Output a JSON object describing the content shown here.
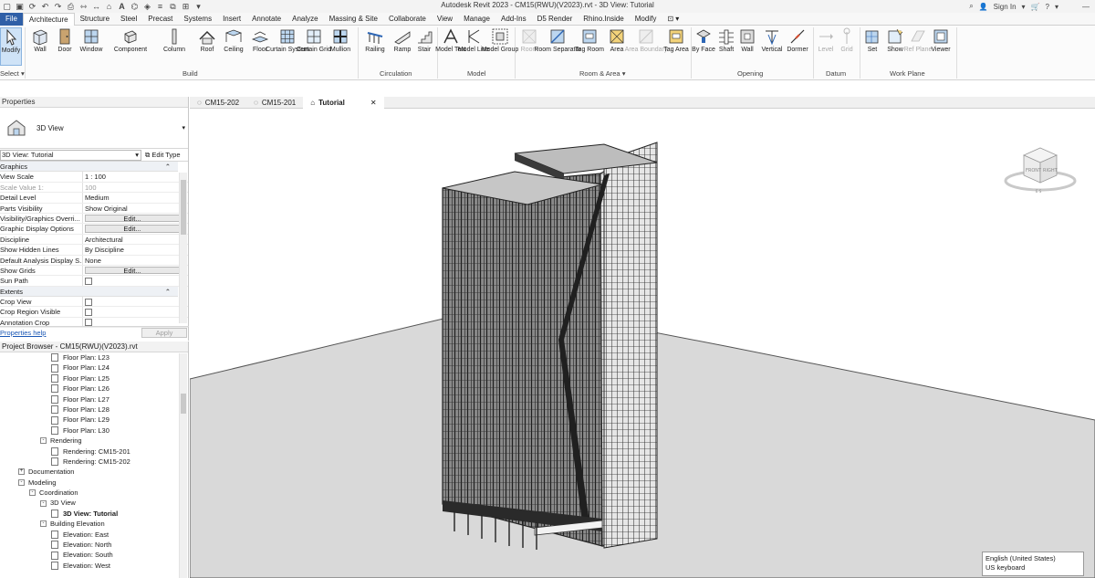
{
  "window": {
    "title": "Autodesk Revit 2023 - CM15(RWU)(V2023).rvt - 3D View: Tutorial",
    "sign_in": "Sign In"
  },
  "tabs": [
    "File",
    "Architecture",
    "Structure",
    "Steel",
    "Precast",
    "Systems",
    "Insert",
    "Annotate",
    "Analyze",
    "Massing & Site",
    "Collaborate",
    "View",
    "Manage",
    "Add-Ins",
    "D5 Render",
    "Rhino.Inside",
    "Modify"
  ],
  "active_tab": "Architecture",
  "ribbon": {
    "modify": "Modify",
    "select": "Select",
    "build": {
      "label": "Build",
      "items": [
        "Wall",
        "Door",
        "Window",
        "Component",
        "Column",
        "Roof",
        "Ceiling",
        "Floor",
        "Curtain System",
        "Curtain Grid",
        "Mullion"
      ]
    },
    "circulation": {
      "label": "Circulation",
      "items": [
        "Railing",
        "Ramp",
        "Stair"
      ]
    },
    "model": {
      "label": "Model",
      "items": [
        "Model Text",
        "Model Line",
        "Model Group"
      ]
    },
    "room_area": {
      "label": "Room & Area",
      "items": [
        "Room",
        "Room Separator",
        "Tag Room",
        "Area",
        "Area Boundary",
        "Tag Area"
      ]
    },
    "opening": {
      "label": "Opening",
      "items": [
        "By Face",
        "Shaft",
        "Wall",
        "Vertical",
        "Dormer"
      ]
    },
    "datum": {
      "label": "Datum",
      "items": [
        "Level",
        "Grid"
      ]
    },
    "work_plane": {
      "label": "Work Plane",
      "items": [
        "Set",
        "Show",
        "Ref Plane",
        "Viewer"
      ]
    }
  },
  "properties": {
    "header": "Properties",
    "type_name": "3D View",
    "instance_selector": "3D View: Tutorial",
    "edit_type": "Edit Type",
    "groups": [
      {
        "name": "Graphics",
        "rows": [
          {
            "k": "View Scale",
            "v": "1 : 100"
          },
          {
            "k": "Scale Value    1:",
            "v": "100",
            "gray": true
          },
          {
            "k": "Detail Level",
            "v": "Medium"
          },
          {
            "k": "Parts Visibility",
            "v": "Show Original"
          },
          {
            "k": "Visibility/Graphics Overri...",
            "v": "Edit...",
            "btn": true
          },
          {
            "k": "Graphic Display Options",
            "v": "Edit...",
            "btn": true
          },
          {
            "k": "Discipline",
            "v": "Architectural"
          },
          {
            "k": "Show Hidden Lines",
            "v": "By Discipline"
          },
          {
            "k": "Default Analysis Display S...",
            "v": "None"
          },
          {
            "k": "Show Grids",
            "v": "Edit...",
            "btn": true
          },
          {
            "k": "Sun Path",
            "v": "",
            "check": true
          }
        ]
      },
      {
        "name": "Extents",
        "rows": [
          {
            "k": "Crop View",
            "v": "",
            "check": true
          },
          {
            "k": "Crop Region Visible",
            "v": "",
            "check": true
          },
          {
            "k": "Annotation Crop",
            "v": "",
            "check": true
          }
        ]
      }
    ],
    "help": "Properties help",
    "apply": "Apply"
  },
  "browser": {
    "header": "Project Browser - CM15(RWU)(V2023).rvt",
    "rows": [
      {
        "t": "Floor Plan: L23",
        "lvl": 4,
        "doc": true
      },
      {
        "t": "Floor Plan: L24",
        "lvl": 4,
        "doc": true
      },
      {
        "t": "Floor Plan: L25",
        "lvl": 4,
        "doc": true
      },
      {
        "t": "Floor Plan: L26",
        "lvl": 4,
        "doc": true
      },
      {
        "t": "Floor Plan: L27",
        "lvl": 4,
        "doc": true
      },
      {
        "t": "Floor Plan: L28",
        "lvl": 4,
        "doc": true
      },
      {
        "t": "Floor Plan: L29",
        "lvl": 4,
        "doc": true
      },
      {
        "t": "Floor Plan: L30",
        "lvl": 4,
        "doc": true
      },
      {
        "t": "Rendering",
        "lvl": 3,
        "exp": "-"
      },
      {
        "t": "Rendering: CM15-201",
        "lvl": 4,
        "doc": true
      },
      {
        "t": "Rendering: CM15-202",
        "lvl": 4,
        "doc": true
      },
      {
        "t": "Documentation",
        "lvl": 1,
        "exp": "+"
      },
      {
        "t": "Modeling",
        "lvl": 1,
        "exp": "-"
      },
      {
        "t": "Coordination",
        "lvl": 2,
        "exp": "-"
      },
      {
        "t": "3D View",
        "lvl": 3,
        "exp": "-"
      },
      {
        "t": "3D View: Tutorial",
        "lvl": 4,
        "doc": true,
        "sel": true
      },
      {
        "t": "Building Elevation",
        "lvl": 3,
        "exp": "-"
      },
      {
        "t": "Elevation: East",
        "lvl": 4,
        "doc": true
      },
      {
        "t": "Elevation: North",
        "lvl": 4,
        "doc": true
      },
      {
        "t": "Elevation: South",
        "lvl": 4,
        "doc": true
      },
      {
        "t": "Elevation: West",
        "lvl": 4,
        "doc": true
      }
    ]
  },
  "view_tabs": [
    {
      "label": "CM15-202",
      "active": false
    },
    {
      "label": "CM15-201",
      "active": false
    },
    {
      "label": "Tutorial",
      "active": true
    }
  ],
  "viewcube": {
    "front": "FRONT",
    "right": "RIGHT",
    "compass": "E S"
  },
  "language_popup": {
    "line1": "English (United States)",
    "line2": "US keyboard"
  }
}
